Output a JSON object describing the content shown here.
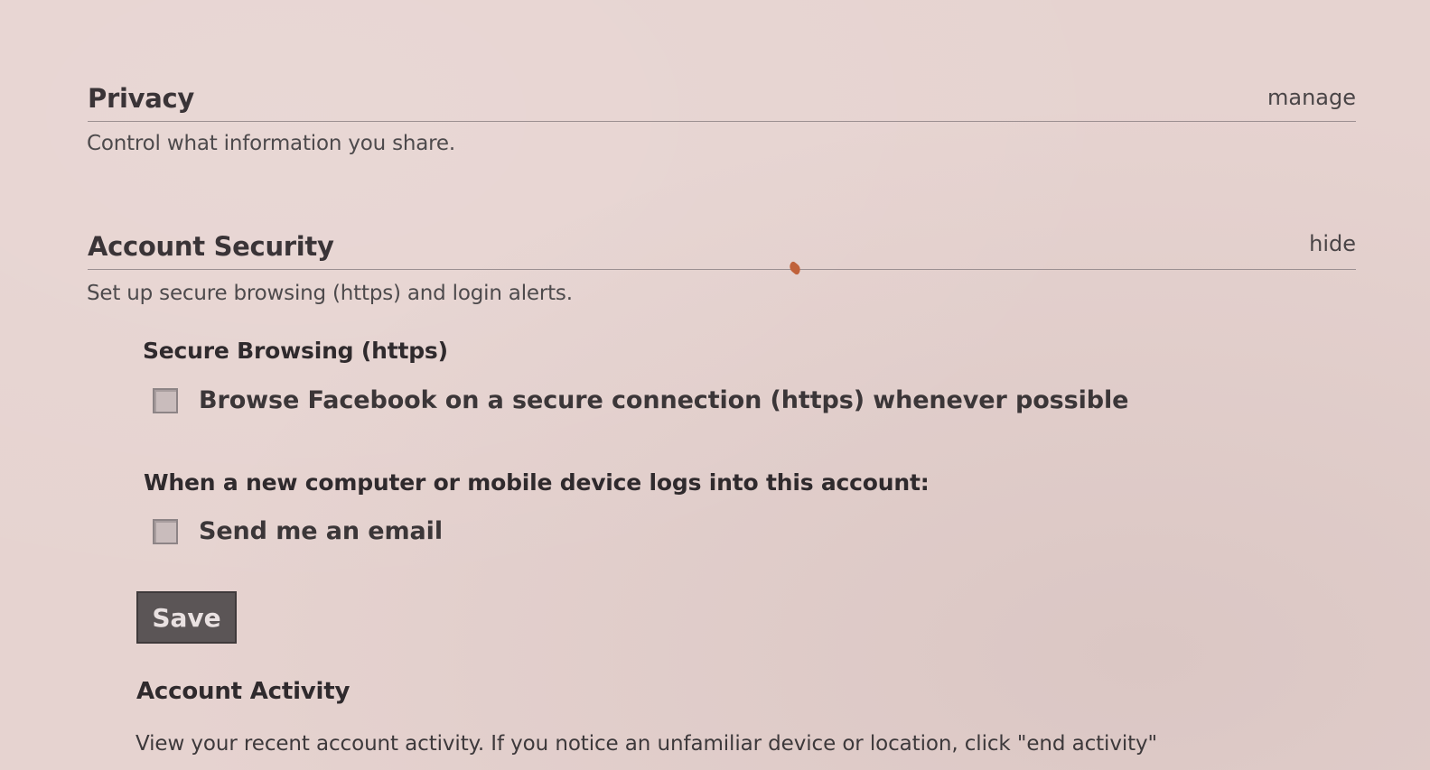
{
  "privacy": {
    "title": "Privacy",
    "action": "manage",
    "description": "Control what information you share."
  },
  "account_security": {
    "title": "Account Security",
    "action": "hide",
    "description": "Set up secure browsing (https) and login alerts.",
    "secure_browsing": {
      "heading": "Secure Browsing (https)",
      "checkbox_label": "Browse Facebook on a secure connection (https) whenever possible",
      "checked": false
    },
    "login_alerts": {
      "heading": "When a new computer or mobile device logs into this account:",
      "checkbox_label": "Send me an email",
      "checked": false
    },
    "save_label": "Save"
  },
  "account_activity": {
    "title": "Account Activity",
    "description": "View your recent account activity. If you notice an unfamiliar device or location, click \"end activity\""
  },
  "colors": {
    "background": "#e6d3d0",
    "button": "#5b5556",
    "text": "#3a3536"
  }
}
